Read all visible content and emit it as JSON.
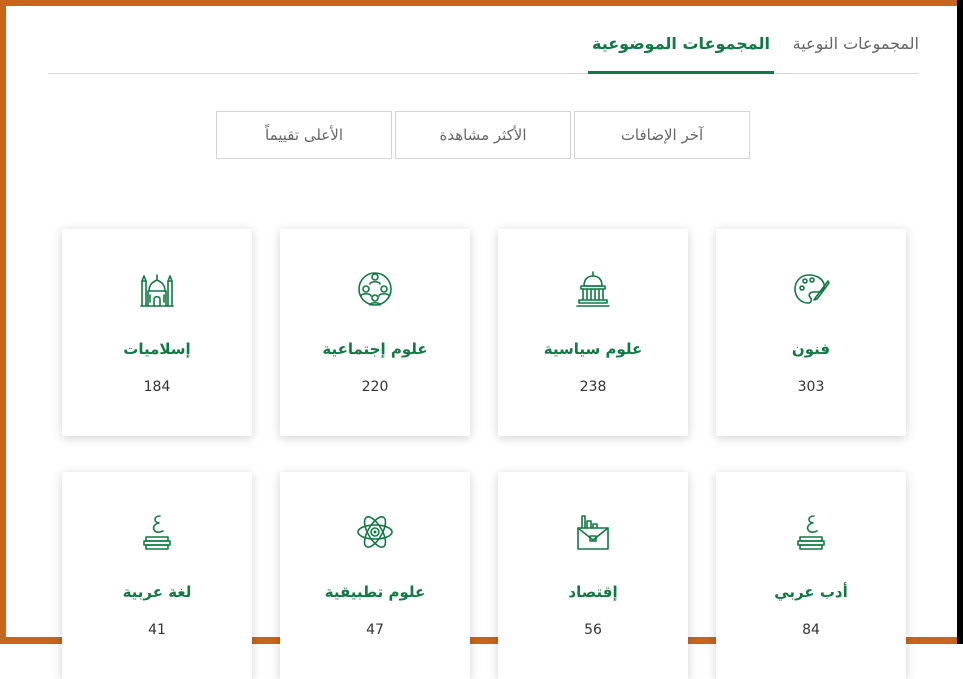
{
  "tabs": [
    {
      "label": "المجموعات النوعية",
      "active": false
    },
    {
      "label": "المجموعات الموضوعية",
      "active": true
    }
  ],
  "sort_buttons": {
    "latest": "آخر الإضافات",
    "most_viewed": "الأكثر مشاهدة",
    "top_rated": "الأعلى تقييماً"
  },
  "categories": [
    {
      "name": "فنون",
      "count": "303",
      "icon": "palette-icon"
    },
    {
      "name": "علوم سياسية",
      "count": "238",
      "icon": "capitol-building-icon"
    },
    {
      "name": "علوم إجتماعية",
      "count": "220",
      "icon": "people-network-icon"
    },
    {
      "name": "إسلاميات",
      "count": "184",
      "icon": "mosque-icon"
    },
    {
      "name": "أدب عربي",
      "count": "84",
      "icon": "arabic-letter-books-icon"
    },
    {
      "name": "إقتصاد",
      "count": "56",
      "icon": "briefcase-chart-icon"
    },
    {
      "name": "علوم تطبيقية",
      "count": "47",
      "icon": "atom-icon"
    },
    {
      "name": "لغة عربية",
      "count": "41",
      "icon": "arabic-letter-books-icon"
    }
  ],
  "colors": {
    "accent": "#0f7a43",
    "frame": "#c8651b"
  }
}
